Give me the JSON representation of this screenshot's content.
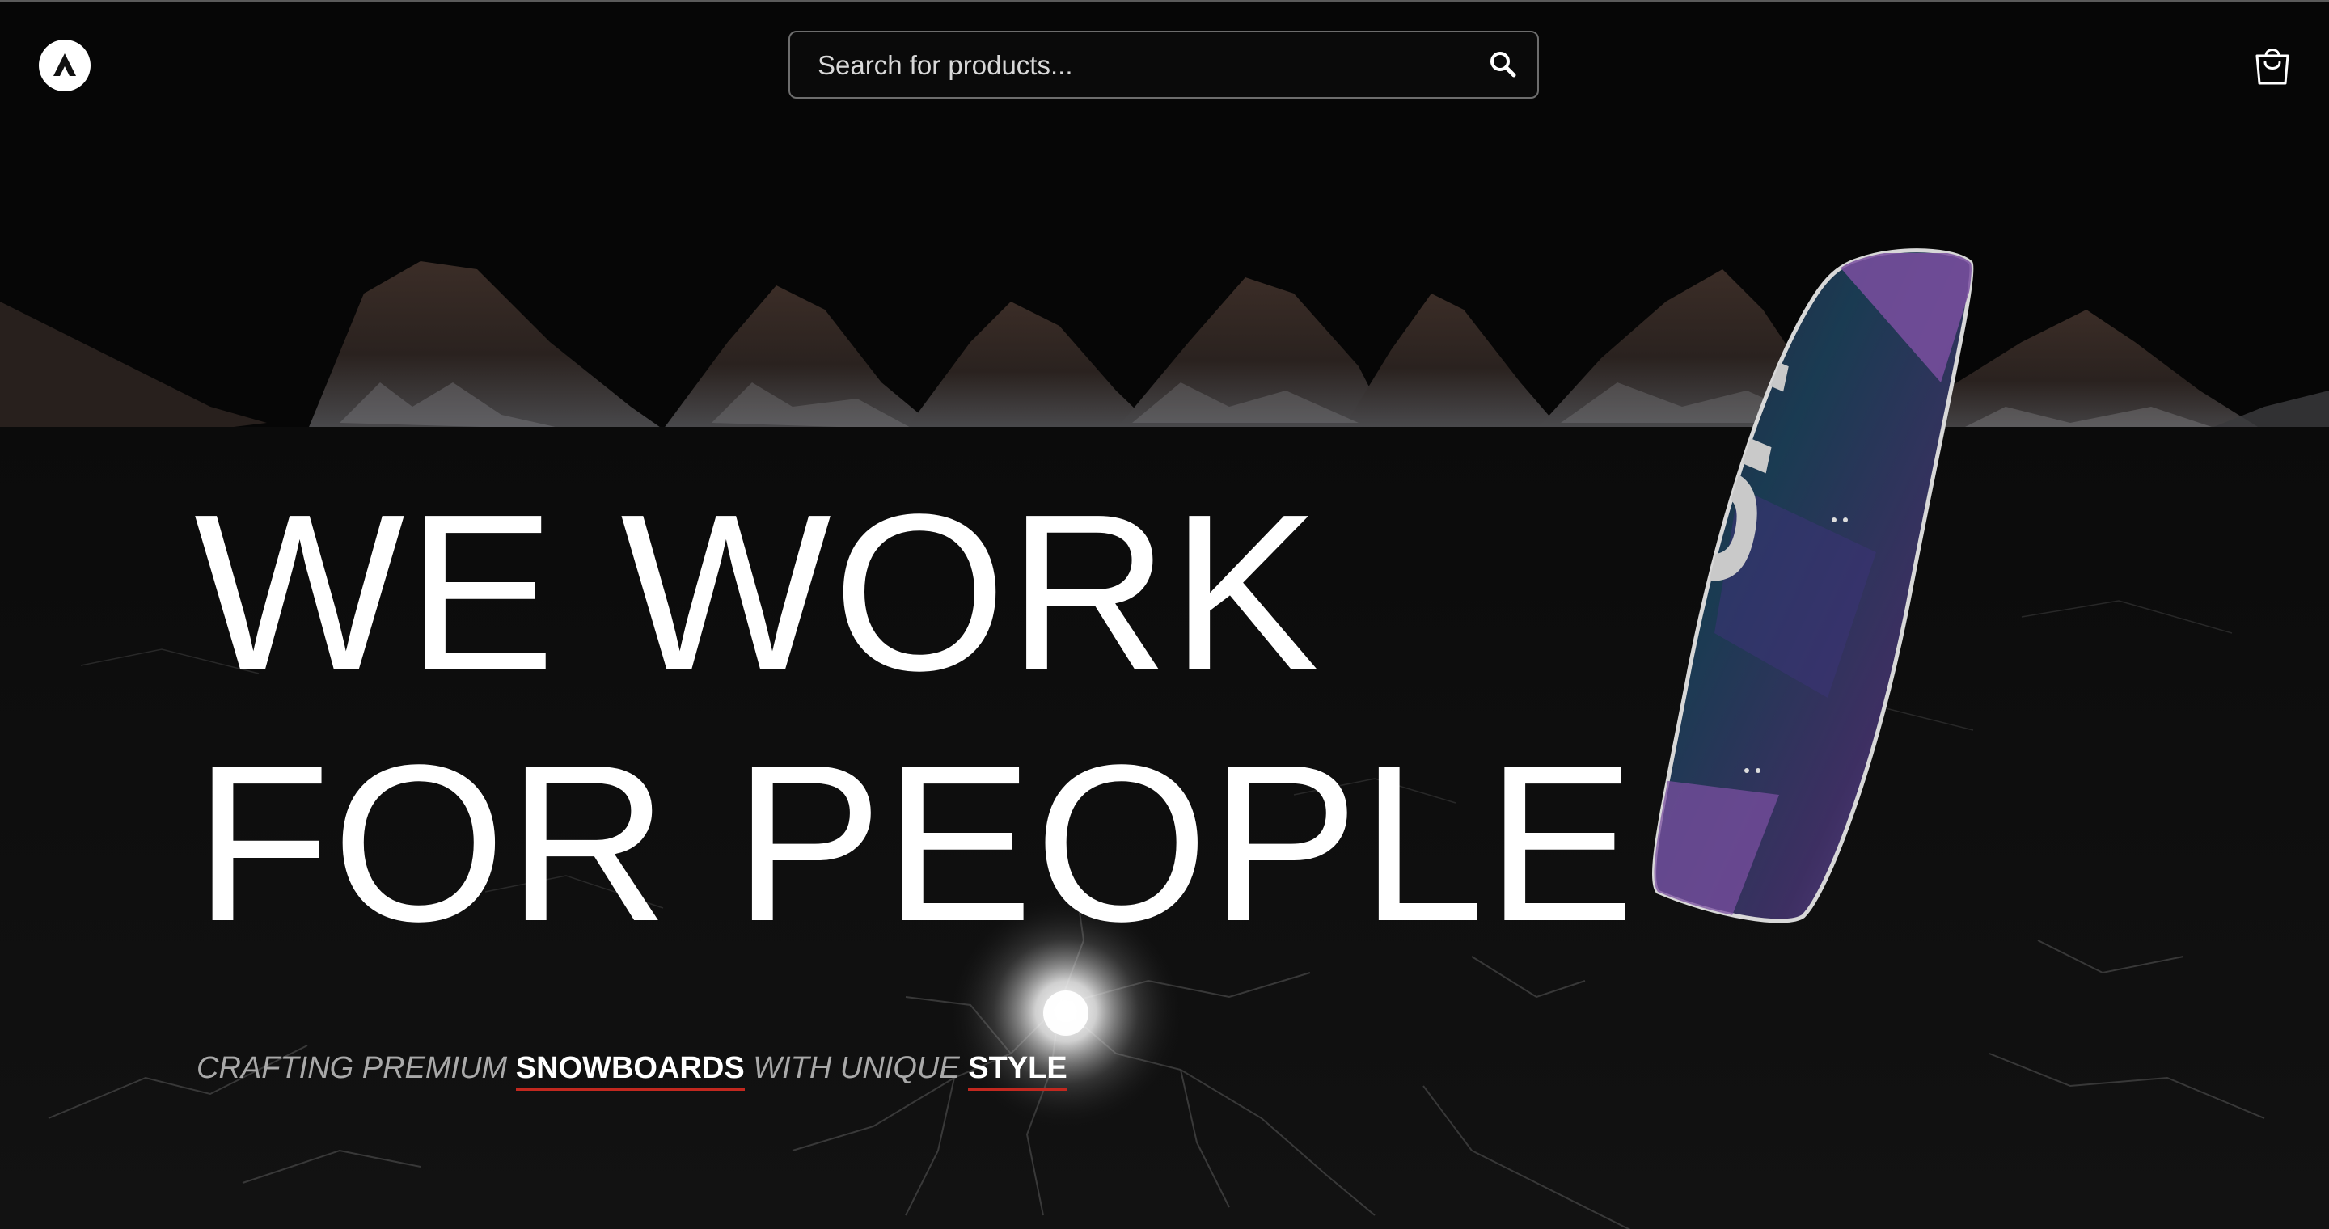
{
  "header": {
    "logo_icon": "triangle-logo-icon",
    "search": {
      "placeholder": "Search for products...",
      "value": "",
      "icon": "search-icon"
    },
    "cart_icon": "shopping-bag-icon"
  },
  "hero": {
    "headline_line1": "WE WORK",
    "headline_line2": "FOR PEOPLE",
    "tagline": {
      "part1": "CRAFTING PREMIUM",
      "highlight1": "SNOWBOARDS",
      "part2": "WITH UNIQUE",
      "highlight2": "STYLE"
    },
    "snowboard_graphic_text": "SHOFFY"
  },
  "colors": {
    "background": "#050505",
    "text": "#ffffff",
    "muted_text": "#a9a9a9",
    "accent_underline": "#c2281f",
    "board_purple": "#7a4fa0",
    "board_teal": "#1c3f55"
  }
}
